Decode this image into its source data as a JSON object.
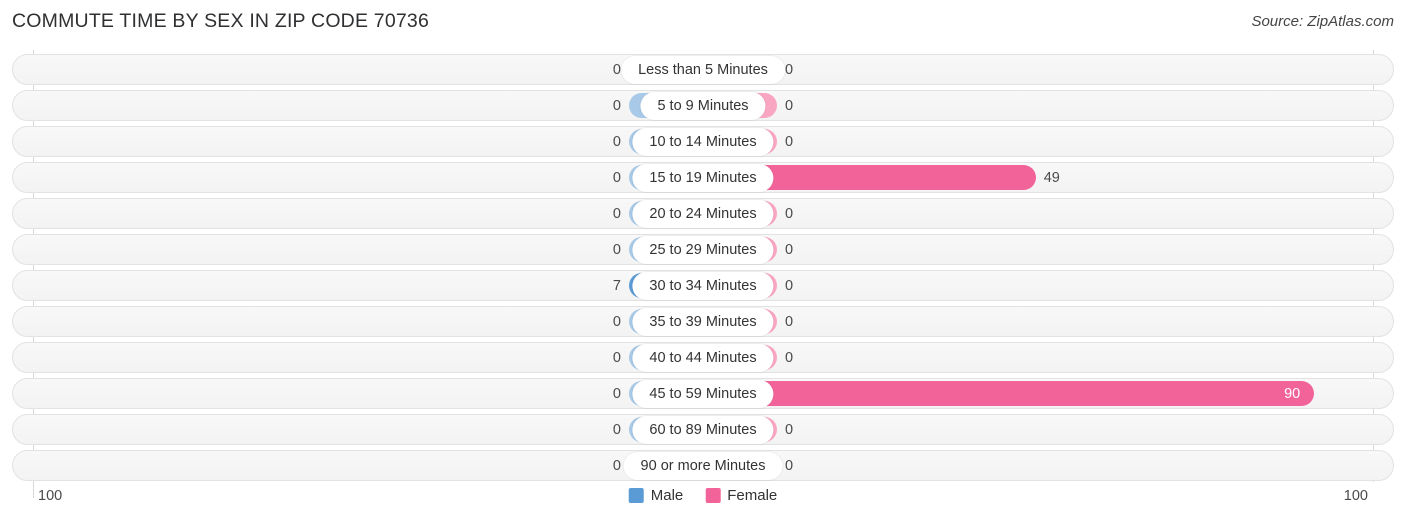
{
  "header": {
    "title": "COMMUTE TIME BY SEX IN ZIP CODE 70736",
    "source": "Source: ZipAtlas.com"
  },
  "axis": {
    "left_max": "100",
    "right_max": "100"
  },
  "legend": {
    "items": [
      {
        "label": "Male",
        "color": "#5b9bd5"
      },
      {
        "label": "Female",
        "color": "#f2639a"
      }
    ]
  },
  "colors": {
    "male_strong": "#5b9bd5",
    "male_zero": "#a9c9e8",
    "female_strong": "#f2639a",
    "female_zero": "#f9a6c2",
    "track": "#f5f5f5",
    "track_border": "#e2e2e2",
    "gridline": "#d8d8d8"
  },
  "chart_data": {
    "type": "bar",
    "title": "COMMUTE TIME BY SEX IN ZIP CODE 70736",
    "subtitle": "Source: ZipAtlas.com",
    "orientation": "horizontal-diverging",
    "xlabel": "",
    "ylabel": "",
    "xlim": [
      100,
      100
    ],
    "grid": true,
    "legend_position": "bottom-center",
    "categories": [
      "Less than 5 Minutes",
      "5 to 9 Minutes",
      "10 to 14 Minutes",
      "15 to 19 Minutes",
      "20 to 24 Minutes",
      "25 to 29 Minutes",
      "30 to 34 Minutes",
      "35 to 39 Minutes",
      "40 to 44 Minutes",
      "45 to 59 Minutes",
      "60 to 89 Minutes",
      "90 or more Minutes"
    ],
    "series": [
      {
        "name": "Male",
        "color": "#5b9bd5",
        "values": [
          0,
          0,
          0,
          0,
          0,
          0,
          7,
          0,
          0,
          0,
          0,
          0
        ]
      },
      {
        "name": "Female",
        "color": "#f2639a",
        "values": [
          0,
          0,
          0,
          49,
          0,
          0,
          0,
          0,
          0,
          90,
          0,
          0
        ]
      }
    ]
  },
  "rows": [
    {
      "label": "Less than 5 Minutes",
      "male": "0",
      "female": "0"
    },
    {
      "label": "5 to 9 Minutes",
      "male": "0",
      "female": "0"
    },
    {
      "label": "10 to 14 Minutes",
      "male": "0",
      "female": "0"
    },
    {
      "label": "15 to 19 Minutes",
      "male": "0",
      "female": "49"
    },
    {
      "label": "20 to 24 Minutes",
      "male": "0",
      "female": "0"
    },
    {
      "label": "25 to 29 Minutes",
      "male": "0",
      "female": "0"
    },
    {
      "label": "30 to 34 Minutes",
      "male": "7",
      "female": "0"
    },
    {
      "label": "35 to 39 Minutes",
      "male": "0",
      "female": "0"
    },
    {
      "label": "40 to 44 Minutes",
      "male": "0",
      "female": "0"
    },
    {
      "label": "45 to 59 Minutes",
      "male": "0",
      "female": "90"
    },
    {
      "label": "60 to 89 Minutes",
      "male": "0",
      "female": "0"
    },
    {
      "label": "90 or more Minutes",
      "male": "0",
      "female": "0"
    }
  ]
}
